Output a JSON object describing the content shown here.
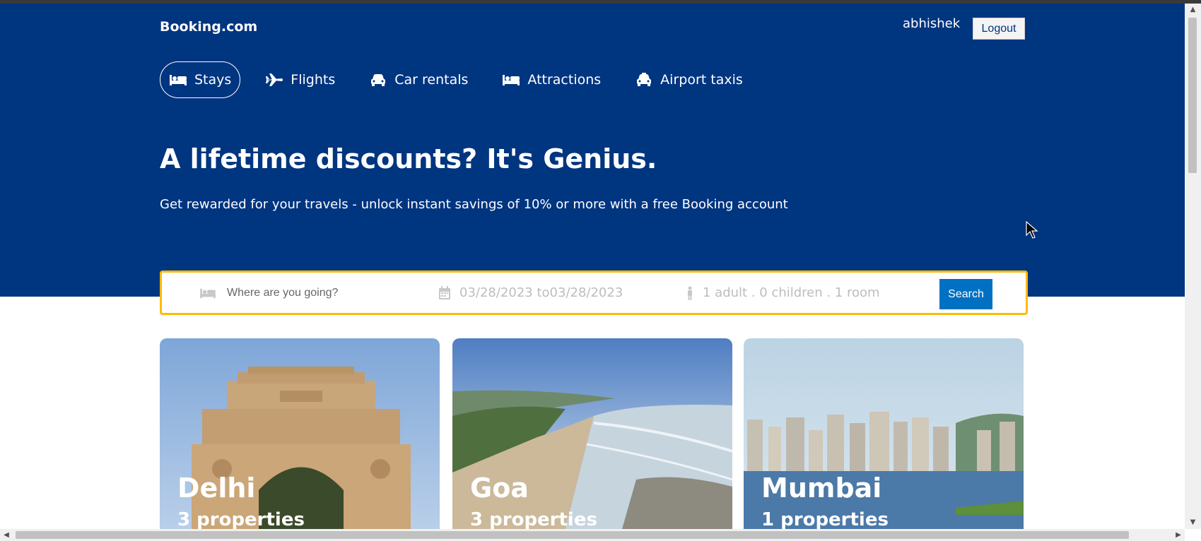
{
  "header": {
    "logo": "Booking.com",
    "username": "abhishek",
    "logout_label": "Logout",
    "headline": "A lifetime discounts? It's Genius.",
    "subline": "Get rewarded for your travels - unlock instant savings of 10% or more with a free Booking account"
  },
  "nav": [
    {
      "label": "Stays",
      "icon": "bed-icon",
      "active": true
    },
    {
      "label": "Flights",
      "icon": "plane-icon"
    },
    {
      "label": "Car rentals",
      "icon": "car-icon"
    },
    {
      "label": "Attractions",
      "icon": "bed-icon"
    },
    {
      "label": "Airport taxis",
      "icon": "taxi-icon"
    }
  ],
  "search": {
    "destination_placeholder": "Where are you going?",
    "dates": "03/28/2023 to03/28/2023",
    "guests": "1 adult . 0 children . 1 room",
    "button_label": "Search"
  },
  "cards": [
    {
      "city": "Delhi",
      "properties": "3 properties"
    },
    {
      "city": "Goa",
      "properties": "3 properties"
    },
    {
      "city": "Mumbai",
      "properties": "1 properties"
    }
  ],
  "colors": {
    "brand_blue": "#003580",
    "search_border": "#febb02",
    "search_button": "#0071c2"
  }
}
